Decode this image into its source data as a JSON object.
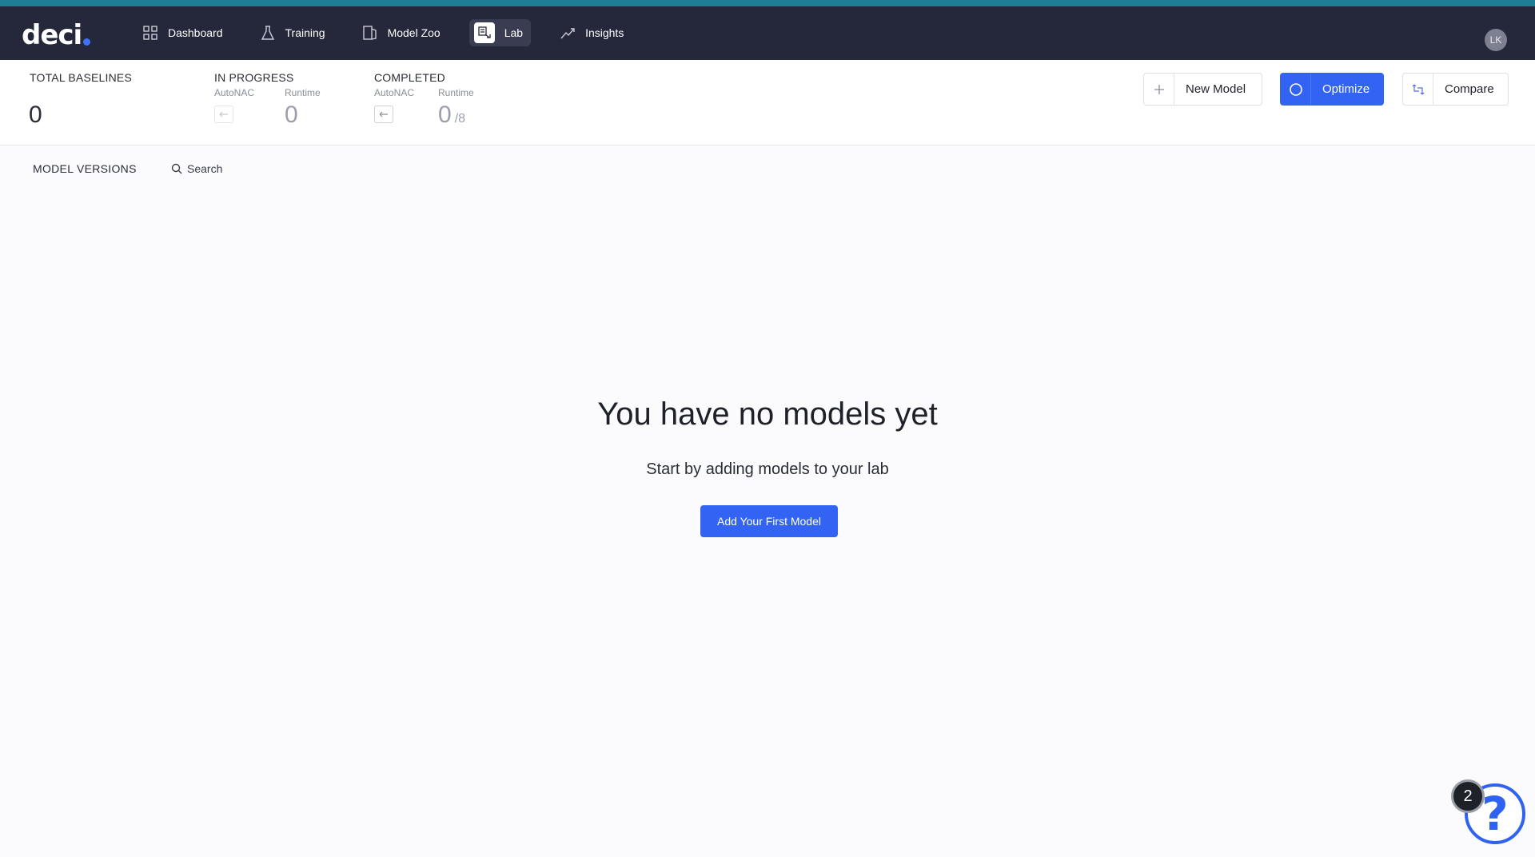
{
  "app": {
    "logo_text": "deci"
  },
  "nav": {
    "items": [
      {
        "label": "Dashboard",
        "icon": "grid-icon"
      },
      {
        "label": "Training",
        "icon": "flask-icon"
      },
      {
        "label": "Model Zoo",
        "icon": "model-zoo-icon"
      },
      {
        "label": "Lab",
        "icon": "lab-icon",
        "active": true
      },
      {
        "label": "Insights",
        "icon": "trend-icon"
      }
    ],
    "user_initials": "LK"
  },
  "stats": {
    "total_baselines": {
      "title": "TOTAL BASELINES",
      "value": "0"
    },
    "in_progress": {
      "title": "IN PROGRESS",
      "autonac_label": "AutoNAC",
      "runtime_label": "Runtime",
      "runtime_value": "0"
    },
    "completed": {
      "title": "COMPLETED",
      "autonac_label": "AutoNAC",
      "runtime_label": "Runtime",
      "runtime_value": "0",
      "runtime_total": "/8"
    }
  },
  "actions": {
    "new_model": "New Model",
    "optimize": "Optimize",
    "compare": "Compare"
  },
  "versions": {
    "title": "MODEL VERSIONS",
    "search_placeholder": "Search"
  },
  "empty_state": {
    "title": "You have no models yet",
    "subtitle": "Start by adding models to your lab",
    "cta": "Add Your First Model"
  },
  "help": {
    "badge_count": "2",
    "glyph": "?"
  },
  "colors": {
    "primary": "#3363f3",
    "topbar": "#25273a",
    "accent_strip": "#1e7e96"
  }
}
